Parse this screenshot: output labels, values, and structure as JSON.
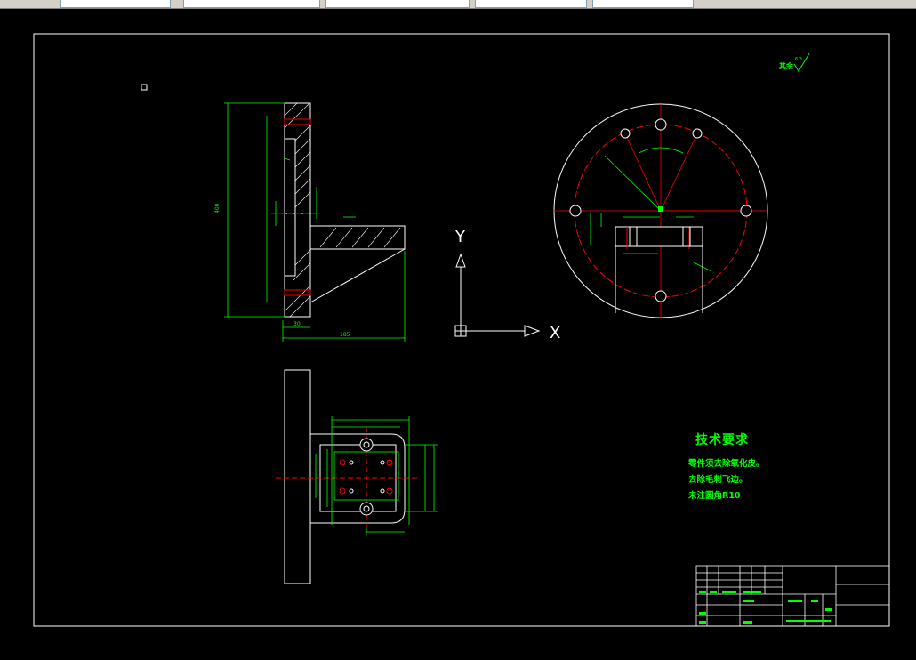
{
  "toolbar": {
    "boxes": [
      "",
      "",
      "",
      "",
      ""
    ]
  },
  "drawing": {
    "roughness_note": "其余",
    "roughness_value": "6.3",
    "dim_total_height": "400",
    "dim_base_width": "185",
    "dim_flange": "30",
    "axis_y": "Y",
    "axis_x": "X"
  },
  "tech_requirements": {
    "title": "技术要求",
    "lines": [
      "零件须去除氧化皮。",
      "去除毛刺飞边。",
      "未注圆角R10"
    ]
  },
  "colors": {
    "line_white": "#ffffff",
    "dim_green": "#00ff00",
    "center_red": "#ff0000",
    "background": "#000000"
  }
}
